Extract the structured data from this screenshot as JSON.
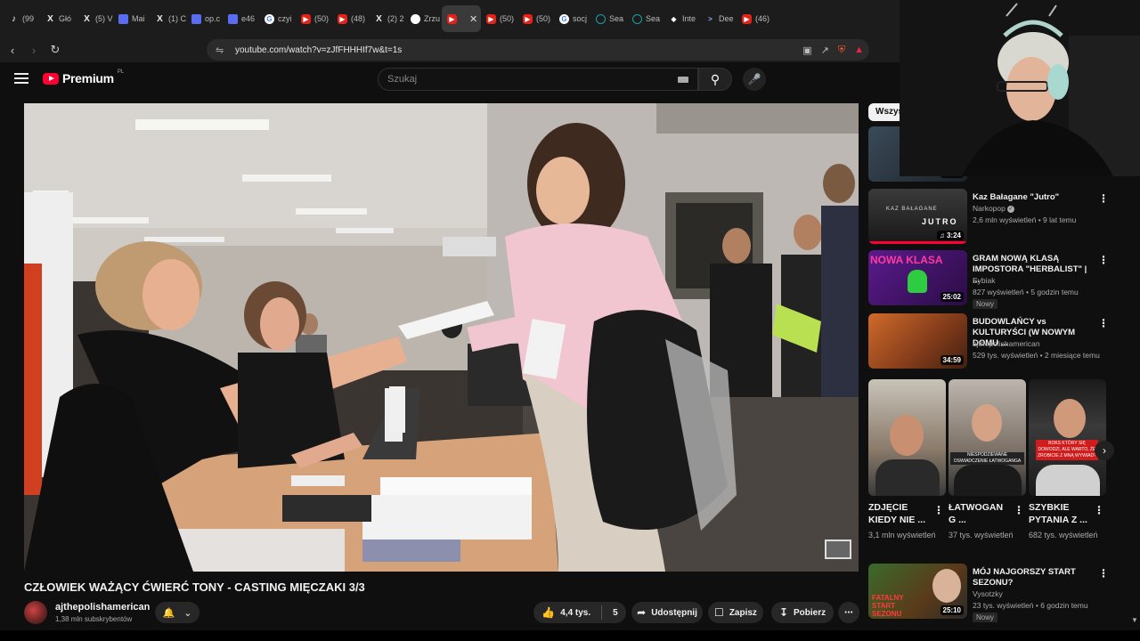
{
  "browser": {
    "tabs": [
      {
        "icon": "tiktok-icon",
        "label": "(99"
      },
      {
        "icon": "x-icon",
        "label": "Głó"
      },
      {
        "icon": "x-icon",
        "label": "(5) V"
      },
      {
        "icon": "mail-icon",
        "label": "Mai"
      },
      {
        "icon": "x-icon",
        "label": "(1) C"
      },
      {
        "icon": "doc-icon",
        "label": "op.c"
      },
      {
        "icon": "doc-icon",
        "label": "e46"
      },
      {
        "icon": "google-icon",
        "label": "czyi"
      },
      {
        "icon": "youtube-icon",
        "label": "(50)"
      },
      {
        "icon": "youtube-icon",
        "label": "(48)"
      },
      {
        "icon": "x-icon",
        "label": "(2) 2"
      },
      {
        "icon": "globe-icon",
        "label": "Zrzu"
      },
      {
        "icon": "youtube-icon",
        "label": "",
        "active": true
      },
      {
        "icon": "youtube-icon",
        "label": "(50)"
      },
      {
        "icon": "youtube-icon",
        "label": "(50)"
      },
      {
        "icon": "google-icon",
        "label": "socj"
      },
      {
        "icon": "ai-icon",
        "label": "Sea"
      },
      {
        "icon": "ai-icon",
        "label": "Sea"
      },
      {
        "icon": "diamond-icon",
        "label": "Inte"
      },
      {
        "icon": "arrow-icon",
        "label": "Dee"
      },
      {
        "icon": "youtube-icon",
        "label": "(46)"
      }
    ],
    "url": "youtube.com/watch?v=zJfFHHHIf7w&t=1s"
  },
  "youtube": {
    "logo_text": "Premium",
    "country_code": "PL",
    "search_placeholder": "Szukaj"
  },
  "video": {
    "title": "CZŁOWIEK WAŻĄCY ĆWIERĆ TONY - CASTING MIĘCZAKI 3/3",
    "channel": "ajthepolishamerican",
    "subscribers": "1,38 mln subskrybentów",
    "likes": "4,4 tys.",
    "dislikes": "5",
    "share_label": "Udostępnij",
    "save_label": "Zapisz",
    "download_label": "Pobierz"
  },
  "sidebar": {
    "chip_label": "Wszys",
    "top_partial_duration": "22:15",
    "recommendations": [
      {
        "title": "Kaz Bałagane \"Jutro\"",
        "channel": "Narkopop",
        "verified": true,
        "meta": "2,6 mln wyświetleń • 9 lat temu",
        "duration": "3:24",
        "badge": ""
      },
      {
        "title": "GRAM NOWĄ KLASĄ IMPOSTORA \"HERBALIST\" | ...",
        "channel": "Eybiak",
        "verified": false,
        "meta": "827 wyświetleń • 5 godzin temu",
        "duration": "25:02",
        "badge": "Nowy"
      },
      {
        "title": "BUDOWLAŃCY vs KULTURYŚCI (W NOWYM DOMU ...",
        "channel": "ajthepolishamerican",
        "verified": false,
        "meta": "529 tys. wyświetleń • 2 miesiące temu",
        "duration": "34:59",
        "badge": ""
      }
    ],
    "shorts": [
      {
        "title": "ZDJĘCIE KIEDY NIE ...",
        "views": "3,1 mln wyświetleń",
        "overlay": ""
      },
      {
        "title": "ŁATWOGAN G ...",
        "views": "37 tys. wyświetleń",
        "overlay": "NIESPODZIEWANE OSWIADCZENIE ŁATWOGANGA"
      },
      {
        "title": "SZYBKIE PYTANIA Z ...",
        "views": "682 tys. wyświetleń",
        "overlay": "BOKS KTÓRY SIĘ DOWODZI, ALE WARTO, ŻE ZROBICIE Z MNĄ WYWIAD?"
      }
    ],
    "last_recommendation": {
      "title": "MÓJ NAJGORSZY START SEZONU?",
      "channel": "Vysotzky",
      "meta": "23 tys. wyświetleń • 6 godzin temu",
      "duration": "25:10",
      "badge": "Nowy",
      "thumb_text": "FATALNY START SEZONU"
    },
    "thumb_texts": {
      "jutro": "JUTRO",
      "kaz": "KAZ BAŁAGANE",
      "nowa": "NOWA KLASA"
    }
  }
}
